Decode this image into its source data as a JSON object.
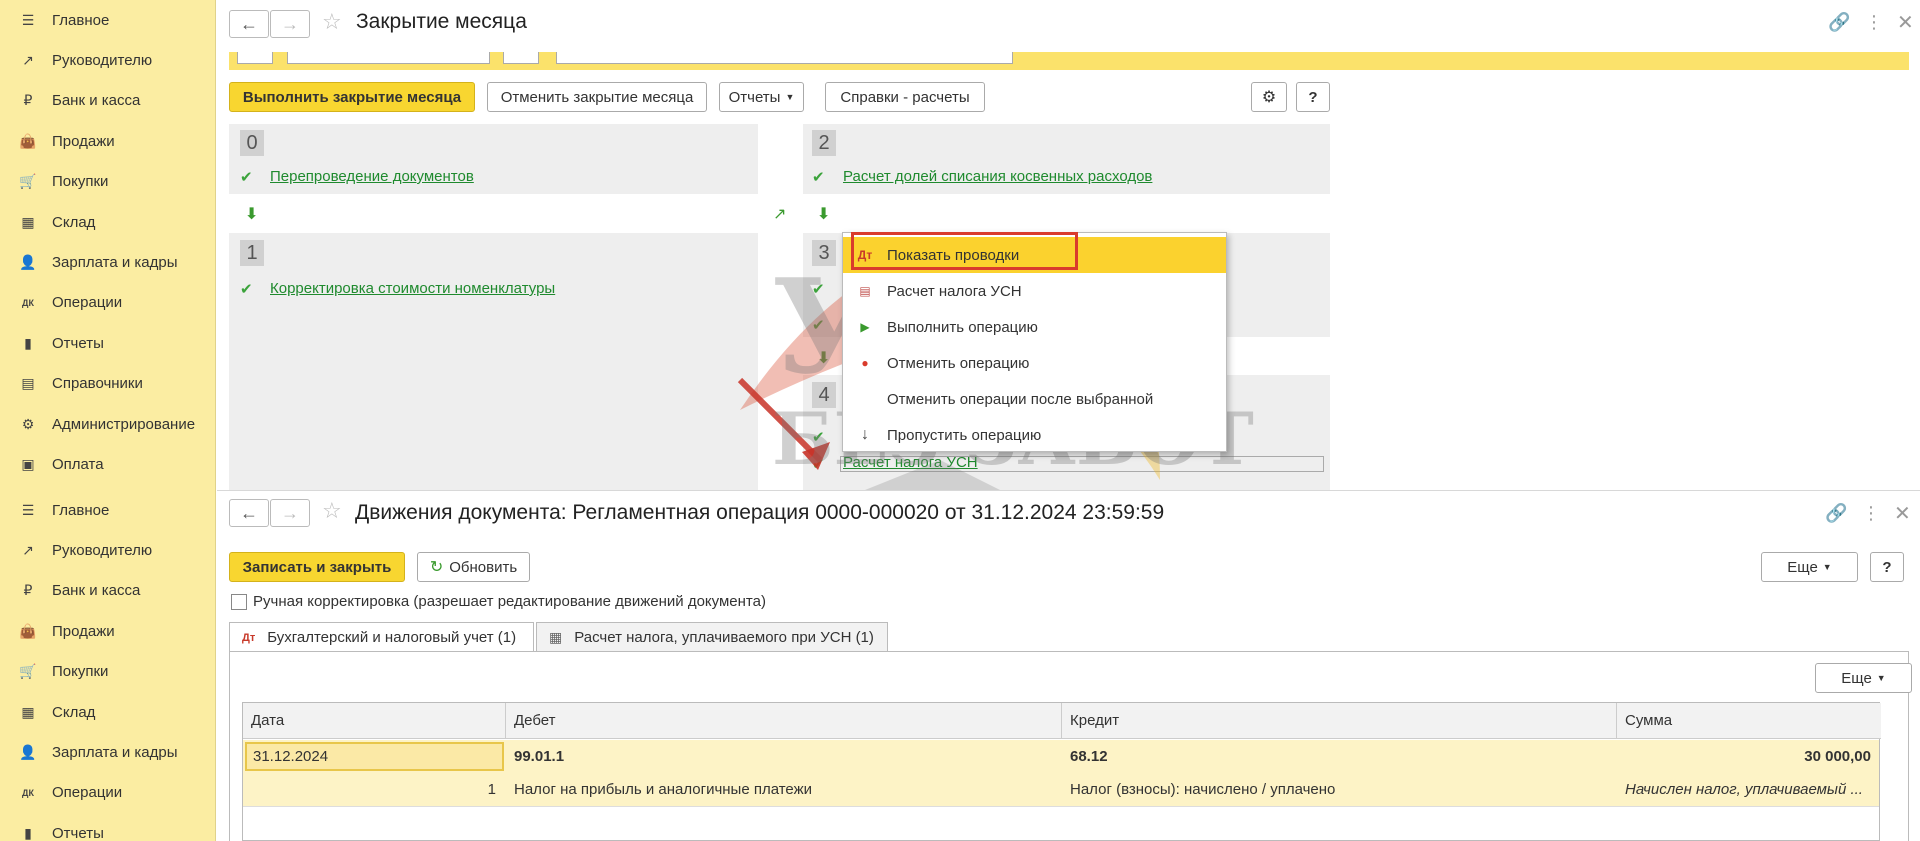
{
  "sidebar": {
    "items": [
      {
        "label": "Главное",
        "icon": "menu-lines-icon"
      },
      {
        "label": "Руководителю",
        "icon": "trend-icon"
      },
      {
        "label": "Банк и касса",
        "icon": "ruble-coin-icon"
      },
      {
        "label": "Продажи",
        "icon": "shopping-bag-icon"
      },
      {
        "label": "Покупки",
        "icon": "cart-icon"
      },
      {
        "label": "Склад",
        "icon": "warehouse-grid-icon"
      },
      {
        "label": "Зарплата и кадры",
        "icon": "person-icon"
      },
      {
        "label": "Операции",
        "icon": "dt-kt-icon"
      },
      {
        "label": "Отчеты",
        "icon": "bar-chart-icon"
      },
      {
        "label": "Справочники",
        "icon": "books-icon"
      },
      {
        "label": "Администрирование",
        "icon": "gear-icon"
      },
      {
        "label": "Оплата",
        "icon": "payment-icon"
      }
    ]
  },
  "closing": {
    "title": "Закрытие месяца",
    "toolbar": {
      "run": "Выполнить закрытие месяца",
      "cancel": "Отменить закрытие месяца",
      "reports": "Отчеты",
      "refs": "Справки - расчеты",
      "help": "?"
    },
    "steps": {
      "s0": {
        "num": "0",
        "item": "Перепроведение документов"
      },
      "s1": {
        "num": "1",
        "item": "Корректировка стоимости номенклатуры"
      },
      "s2": {
        "num": "2",
        "item": "Расчет долей списания косвенных расходов"
      },
      "s3": {
        "num": "3"
      },
      "s4": {
        "num": "4",
        "item": "Расчет налога УСН"
      }
    },
    "menu": [
      {
        "label": "Показать проводки",
        "icon": "dt-kt-icon"
      },
      {
        "label": "Расчет налога УСН",
        "icon": "report-icon"
      },
      {
        "label": "Выполнить операцию",
        "icon": "run-operation-icon"
      },
      {
        "label": "Отменить операцию",
        "icon": "cancel-operation-icon"
      },
      {
        "label": "Отменить операции после выбранной",
        "icon": ""
      },
      {
        "label": "Пропустить операцию",
        "icon": "arrow-down-icon"
      }
    ]
  },
  "watermark": {
    "line1": "УЧЕТ",
    "line2": "БЕЗ ЗАБОТ"
  },
  "movements": {
    "title": "Движения документа: Регламентная операция 0000-000020 от 31.12.2024 23:59:59",
    "toolbar": {
      "save_close": "Записать и закрыть",
      "refresh": "Обновить",
      "more": "Еще",
      "help": "?"
    },
    "manual": "Ручная корректировка (разрешает редактирование движений документа)",
    "tabs": [
      {
        "label": "Бухгалтерский и налоговый учет (1)"
      },
      {
        "label": "Расчет налога, уплачиваемого при УСН (1)"
      }
    ],
    "grid_more": "Еще",
    "columns": [
      "Дата",
      "Дебет",
      "Кредит",
      "Сумма"
    ],
    "row": {
      "date": "31.12.2024",
      "debit": "99.01.1",
      "credit": "68.12",
      "sum": "30 000,00",
      "line": "1",
      "debit_sub": "Налог на прибыль и аналогичные платежи",
      "credit_sub": "Налог (взносы): начислено / уплачено",
      "content": "Начислен налог, уплачиваемый ..."
    }
  }
}
